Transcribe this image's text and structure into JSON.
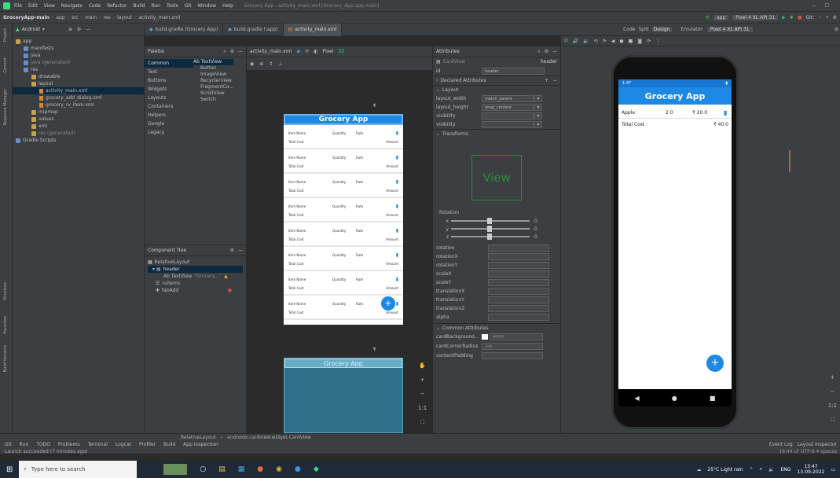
{
  "app": {
    "menus": [
      "File",
      "Edit",
      "View",
      "Navigate",
      "Code",
      "Refactor",
      "Build",
      "Run",
      "Tools",
      "Git",
      "Window",
      "Help"
    ],
    "window_title": "Grocery App - activity_main.xml [Grocery_App.app.main]"
  },
  "breadcrumb": [
    "GroceryApp-main",
    "app",
    "src",
    "main",
    "res",
    "layout",
    "activity_main.xml"
  ],
  "run_config": {
    "module": "app",
    "device": "Pixel 4 XL API 31",
    "git_label": "Git:"
  },
  "editor_tabs": [
    "build.gradle (Grocery App)",
    "build.gradle (:app)",
    "activity_main.xml"
  ],
  "side_labels": {
    "project": "Project",
    "commit": "Commit",
    "resource": "Resource Manager",
    "structure": "Structure",
    "favorites": "Favorites",
    "build_variants": "Build Variants"
  },
  "project": {
    "view": "Android",
    "items": [
      {
        "label": "app",
        "depth": 0
      },
      {
        "label": "manifests",
        "depth": 1
      },
      {
        "label": "java",
        "depth": 1
      },
      {
        "label": "java (generated)",
        "depth": 1
      },
      {
        "label": "res",
        "depth": 1
      },
      {
        "label": "drawable",
        "depth": 2
      },
      {
        "label": "layout",
        "depth": 2
      },
      {
        "label": "activity_main.xml",
        "depth": 3
      },
      {
        "label": "grocery_add_dialog.xml",
        "depth": 3
      },
      {
        "label": "grocery_rv_item.xml",
        "depth": 3
      },
      {
        "label": "mipmap",
        "depth": 2
      },
      {
        "label": "values",
        "depth": 2
      },
      {
        "label": "xml",
        "depth": 2
      },
      {
        "label": "res (generated)",
        "depth": 2
      },
      {
        "label": "Gradle Scripts",
        "depth": 0
      }
    ]
  },
  "palette": {
    "title": "Palette",
    "categories": [
      "Common",
      "Text",
      "Buttons",
      "Widgets",
      "Layouts",
      "Containers",
      "Helpers",
      "Google",
      "Legacy"
    ],
    "widgets": [
      "Ab TextView",
      "Button",
      "ImageView",
      "RecyclerView",
      "FragmentCo...",
      "ScrollView",
      "Switch"
    ]
  },
  "component_tree": {
    "title": "Component Tree",
    "items": [
      "RelativeLayout",
      "header",
      "Ab TextView",
      "\"Grocery...\"",
      "rvitems",
      "fabAdd"
    ]
  },
  "design_toolbar": {
    "file": "activity_main.xml",
    "device": "Pixel",
    "api": "32"
  },
  "preview": {
    "app_title": "Grocery App",
    "item_name": "Item Name",
    "quantity": "Quantity",
    "rate": "Rate",
    "total_cost": "Total Cost",
    "amount": "Amount",
    "row_count": 8
  },
  "attributes": {
    "title": "Attributes",
    "component": "CardView",
    "component_id": "header",
    "id_label": "id",
    "id_value": "header",
    "declared_label": "Declared Attributes",
    "layout_label": "Layout",
    "layout_rows": [
      {
        "label": "layout_width",
        "value": "match_parent"
      },
      {
        "label": "layout_height",
        "value": "wrap_content"
      },
      {
        "label": "visibility",
        "value": ""
      },
      {
        "label": "visibility",
        "value": ""
      }
    ],
    "transforms_label": "Transforms",
    "view_box_text": "View",
    "rotation_label": "Rotation",
    "rotation_axes": [
      {
        "axis": "x",
        "value": "0"
      },
      {
        "axis": "y",
        "value": "0"
      },
      {
        "axis": "z",
        "value": "0"
      }
    ],
    "transform_fields": [
      "rotation",
      "rotationX",
      "rotationY",
      "scaleX",
      "scaleY",
      "translationX",
      "translationY",
      "translationZ",
      "alpha"
    ],
    "common_label": "Common Attributes",
    "common_rows": [
      {
        "label": "cardBackground...",
        "value": "#ffffff"
      },
      {
        "label": "cardCornerRadius",
        "value": "2dp"
      },
      {
        "label": "contentPadding",
        "value": ""
      }
    ]
  },
  "view_modes": {
    "code": "Code",
    "split": "Split",
    "design": "Design"
  },
  "emulator": {
    "label": "Emulator:",
    "device_tab": "Pixel 4 XL API 31",
    "status_time": "1:47",
    "app_title": "Grocery App",
    "item": {
      "name": "Apple",
      "qty": "2.0",
      "rate": "₹ 20.0"
    },
    "total_label": "Total Cost :",
    "total_value": "₹ 40.0",
    "accent": "#1e88e5"
  },
  "status": {
    "path": [
      "RelativeLayout",
      "androidx.cardview.widget.CardView"
    ],
    "tools": [
      "Git",
      "Run",
      "TODO",
      "Problems",
      "Terminal",
      "Logcat",
      "Profiler",
      "Build",
      "App Inspection"
    ],
    "message": "Launch succeeded (7 minutes ago)",
    "right_tools": [
      "Event Log",
      "Layout Inspector"
    ],
    "right_info": "16:44  LF  UTF-8  4 spaces"
  },
  "taskbar": {
    "search_placeholder": "Type here to search",
    "weather": "25°C  Light rain",
    "lang": "ENG",
    "time": "13:47",
    "date": "13-09-2022"
  }
}
